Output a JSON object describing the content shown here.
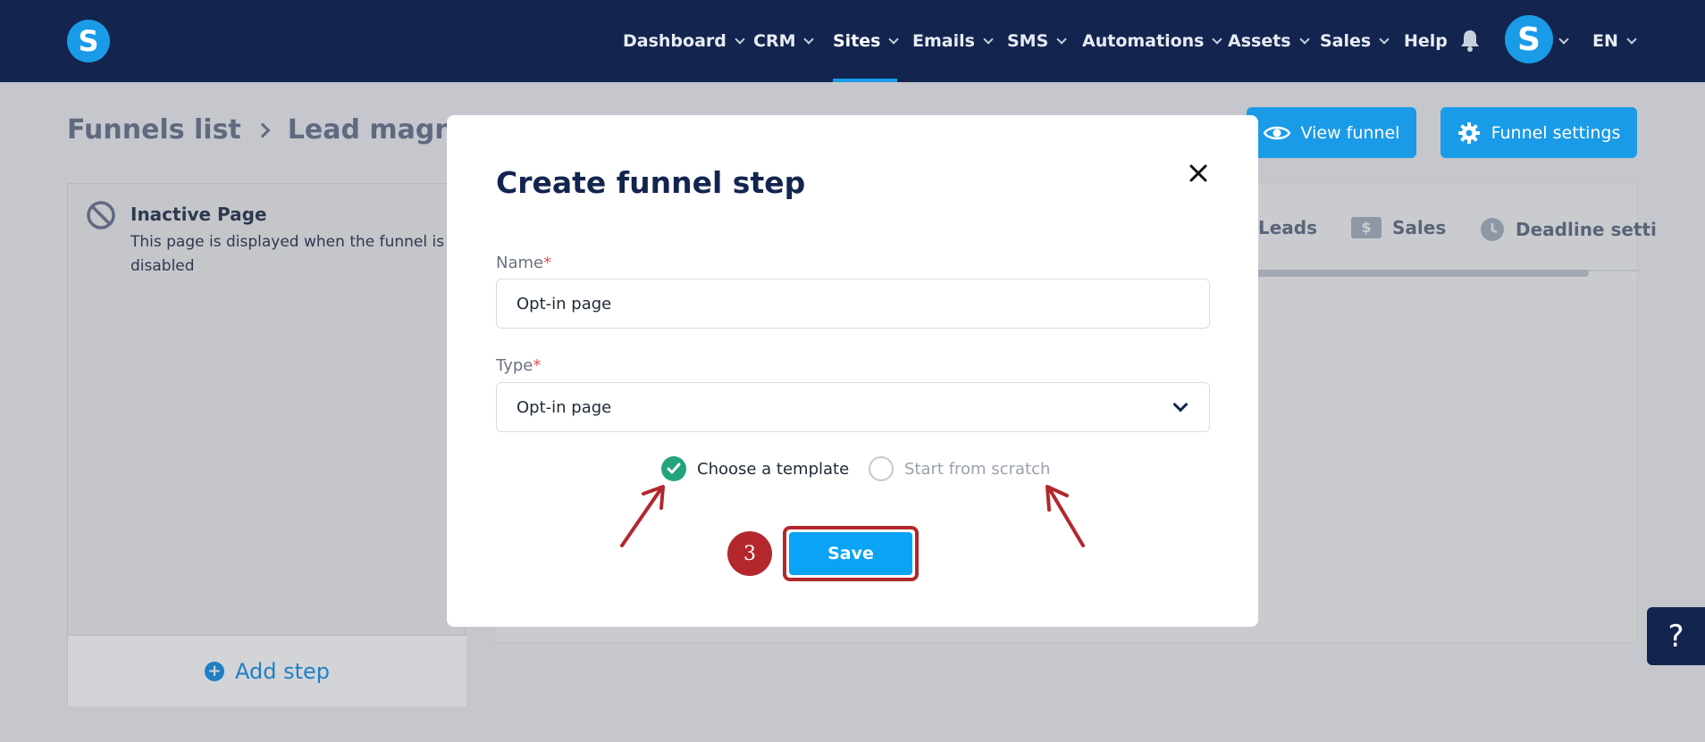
{
  "nav": {
    "logo_letter": "S",
    "items": [
      {
        "label": "Dashboard",
        "dropdown": true
      },
      {
        "label": "CRM",
        "dropdown": true
      },
      {
        "label": "Sites",
        "dropdown": true,
        "active": true
      },
      {
        "label": "Emails",
        "dropdown": true
      },
      {
        "label": "SMS",
        "dropdown": true
      },
      {
        "label": "Automations",
        "dropdown": true
      },
      {
        "label": "Assets",
        "dropdown": true
      },
      {
        "label": "Sales",
        "dropdown": true
      },
      {
        "label": "Help",
        "dropdown": false
      }
    ],
    "avatar_letter": "S",
    "language": "EN"
  },
  "breadcrumb": {
    "items": [
      "Funnels list",
      "Lead magnet"
    ]
  },
  "header_buttons": {
    "view_funnel": "View funnel",
    "funnel_settings": "Funnel settings"
  },
  "sidebar": {
    "step_title": "Inactive Page",
    "step_description": "This page is displayed when the funnel is disabled",
    "add_step": "Add step"
  },
  "tabs": {
    "leads": "Leads",
    "sales": "Sales",
    "sales_icon_glyph": "$",
    "deadline": "Deadline setti"
  },
  "modal": {
    "title": "Create funnel step",
    "name_label": "Name",
    "name_value": "Opt-in page",
    "type_label": "Type",
    "type_value": "Opt-in page",
    "required_mark": "*",
    "option_template": "Choose a template",
    "option_scratch": "Start from scratch",
    "selected_option": "Choose a template",
    "save_label": "Save",
    "step_badge": "3"
  },
  "help": {
    "label": "?"
  },
  "colors": {
    "nav_bg": "#13254f",
    "accent": "#1a9be8",
    "save": "#0aa3f5",
    "highlight": "#b3272d",
    "check": "#22a37c"
  }
}
